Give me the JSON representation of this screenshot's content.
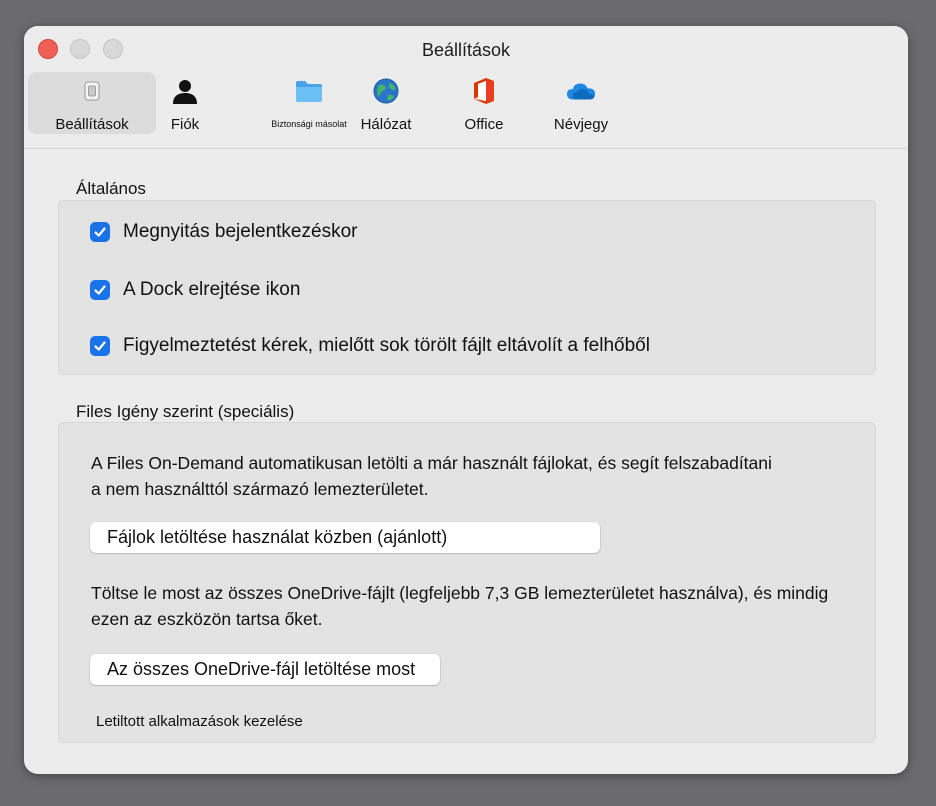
{
  "window": {
    "title": "Beállítások"
  },
  "tabs": [
    {
      "label": "Beállítások",
      "icon": "switch-icon",
      "active": true
    },
    {
      "label": "Fiók",
      "icon": "person-icon",
      "active": false
    },
    {
      "label": "Biztonsági másolat",
      "icon": "folder-icon",
      "active": false
    },
    {
      "label": "Hálózat",
      "icon": "globe-icon",
      "active": false
    },
    {
      "label": "Office",
      "icon": "office-icon",
      "active": false
    },
    {
      "label": "Névjegy",
      "icon": "cloud-icon",
      "active": false
    }
  ],
  "general": {
    "heading": "Általános",
    "options": [
      {
        "label": "Megnyitás bejelentkezéskor",
        "checked": true
      },
      {
        "label": "A Dock elrejtése ikon",
        "checked": true
      },
      {
        "label": "Figyelmeztetést kérek, mielőtt sok törölt fájlt eltávolít a felhőből",
        "checked": true
      }
    ]
  },
  "files_on_demand": {
    "heading": "Files Igény szerint (speciális)",
    "description_line1": "A Files On-Demand automatikusan letölti a már használt fájlokat, és segít felszabadítani",
    "description_line2": "a nem használttól származó lemezterületet.",
    "download_while_using_button": "Fájlok letöltése használat közben (ajánlott)",
    "download_all_line1": "Töltse le most az összes OneDrive-fájlt (legfeljebb 7,3 GB lemezterületet használva), és mindig",
    "download_all_line2": "ezen az eszközön tartsa őket.",
    "download_all_button": "Az összes OneDrive-fájl letöltése most",
    "blocked_apps_link": "Letiltott alkalmazások kezelése"
  },
  "colors": {
    "accent": "#1a73e8",
    "close": "#ee5f58",
    "office": "#d83b01",
    "onedrive": "#0f6cbd"
  }
}
